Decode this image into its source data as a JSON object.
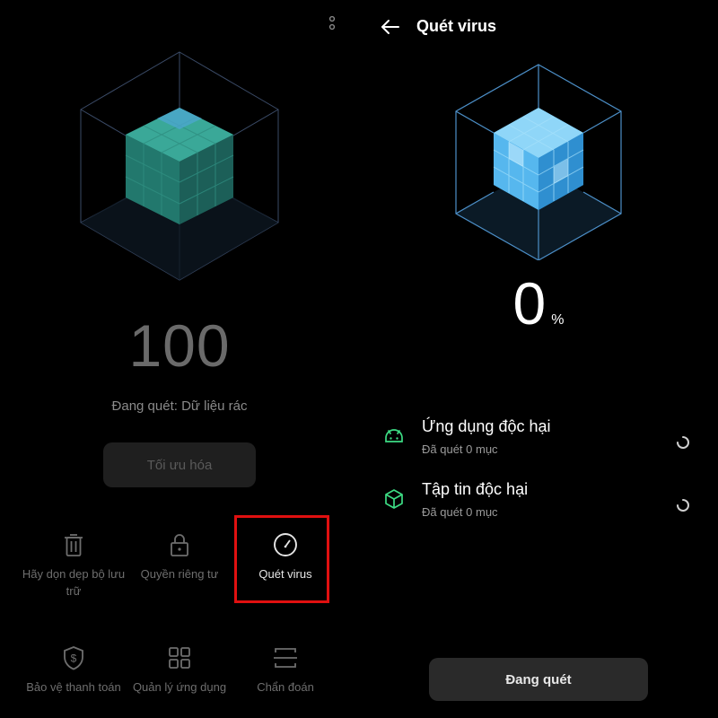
{
  "left_screen": {
    "score": "100",
    "scan_status": "Đang quét: Dữ liệu rác",
    "optimize_label": "Tối ưu hóa",
    "tools": [
      {
        "label": "Hãy dọn dẹp bộ lưu trữ",
        "icon": "trash-icon"
      },
      {
        "label": "Quyền riêng tư",
        "icon": "lock-icon"
      },
      {
        "label": "Quét virus",
        "icon": "speedometer-icon"
      },
      {
        "label": "Bảo vệ thanh toán",
        "icon": "shield-dollar-icon"
      },
      {
        "label": "Quản lý ứng dụng",
        "icon": "apps-grid-icon"
      },
      {
        "label": "Chẩn đoán",
        "icon": "diagnose-icon"
      }
    ]
  },
  "right_screen": {
    "title": "Quét virus",
    "progress_value": "0",
    "progress_unit": "%",
    "items": [
      {
        "title": "Ứng dụng độc hại",
        "subtitle": "Đã quét 0 mục",
        "icon": "android-icon"
      },
      {
        "title": "Tập tin độc hại",
        "subtitle": "Đã quét 0 mục",
        "icon": "file-cube-icon"
      }
    ],
    "scan_button_label": "Đang quét"
  },
  "colors": {
    "background": "#000000",
    "accent_green": "#3ddc84",
    "cube_blue": "#4fb8ea",
    "cube_teal": "#2a8c7f",
    "highlight_red": "#e01010"
  }
}
